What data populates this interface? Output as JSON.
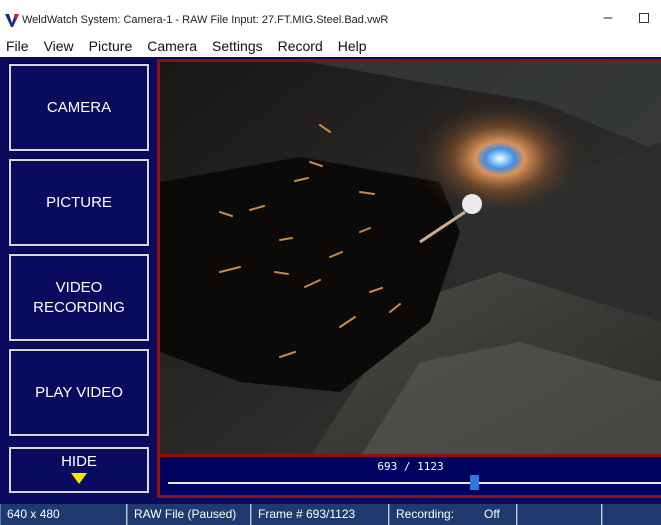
{
  "window": {
    "title": "WeldWatch System:  Camera-1  - RAW File Input:  27.FT.MIG.Steel.Bad.vwR",
    "minimize_glyph": "–",
    "logo_icon": "weldwatch-logo"
  },
  "menu": [
    "File",
    "View",
    "Picture",
    "Camera",
    "Settings",
    "Record",
    "Help"
  ],
  "sidebar": {
    "buttons": [
      {
        "label_line1": "CAMERA",
        "label_line2": ""
      },
      {
        "label_line1": "PICTURE",
        "label_line2": ""
      },
      {
        "label_line1": "VIDEO",
        "label_line2": "RECORDING"
      },
      {
        "label_line1": "PLAY VIDEO",
        "label_line2": ""
      }
    ],
    "hide_label": "HIDE",
    "hide_icon": "triangle-down-icon"
  },
  "playback": {
    "current_frame": "693",
    "separator": "/",
    "total_frames": "1123",
    "progress_fraction": 0.617
  },
  "statusbar": {
    "resolution": "640 x 480",
    "source": "RAW File (Paused)",
    "frame": "Frame #  693/1123",
    "recording_label": "Recording:",
    "recording_value": "Off"
  },
  "colors": {
    "panel_bg": "#0a0a5e",
    "video_border": "#8b1010",
    "status_bg": "#1e3a6e",
    "arrow": "#f5e600",
    "slider_thumb": "#2a79e0"
  }
}
